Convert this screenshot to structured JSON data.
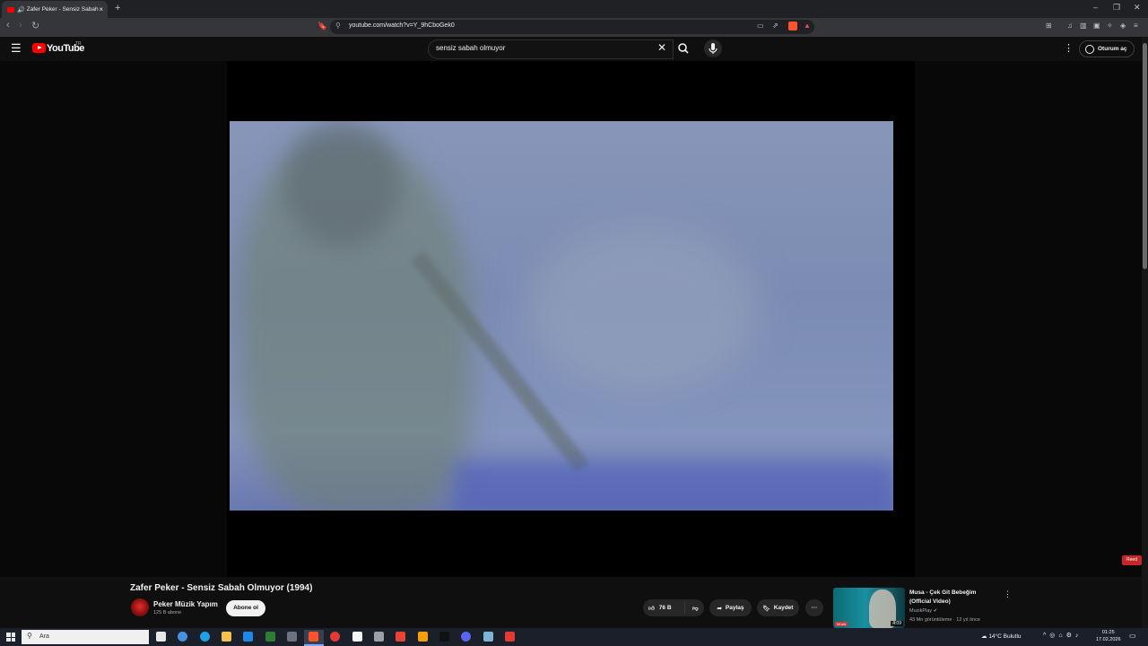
{
  "browser": {
    "tab_title": "Zafer Peker - Sensiz Sabah Ol",
    "tab_close": "×",
    "new_tab": "+",
    "url": "youtube.com/watch?v=Y_9hCboGek0",
    "window_controls": [
      "–",
      "❐",
      "✕"
    ]
  },
  "youtube": {
    "logo_text": "YouTube",
    "region": "TR",
    "search_query": "sensiz sabah olmuyor",
    "clear_label": "✕",
    "signin_label": "Oturum aç"
  },
  "player": {
    "ad_badge": "Reed"
  },
  "video": {
    "title": "Zafer Peker - Sensiz Sabah Olmuyor (1994)",
    "channel": "Peker Müzik Yapım",
    "subscribers": "125 B abone",
    "subscribe_label": "Abone ol",
    "likes": "76 B",
    "share_label": "Paylaş",
    "save_label": "Kaydet",
    "more_label": "···"
  },
  "recommendation": {
    "title": "Musa - Çek Git Bebeğim (Official Video)",
    "channel": "MuzikPlay",
    "meta": "43 Mn görüntüleme · 12 yıl önce",
    "duration": "4:09",
    "badge": "Müzik"
  },
  "taskbar": {
    "search_placeholder": "Ara",
    "weather": "14°C  Bulutlu",
    "time": "01:25",
    "date": "17.02.2026",
    "app_colors": [
      "#e8e8e8",
      "#4a90e2",
      "#1fa0e8",
      "#f2c14e",
      "#1e88e5",
      "#2e7d32",
      "#6b7280",
      "#fb542b",
      "#e53935",
      "#f5f5f5",
      "#9aa0a6",
      "#ea4335",
      "#f59e0b",
      "#111111",
      "#5865f2",
      "#7fb3d5",
      "#e53935"
    ]
  },
  "colors": {
    "youtube_red": "#ff0000",
    "brave_orange": "#fb542b",
    "background": "#0f0f0f"
  }
}
